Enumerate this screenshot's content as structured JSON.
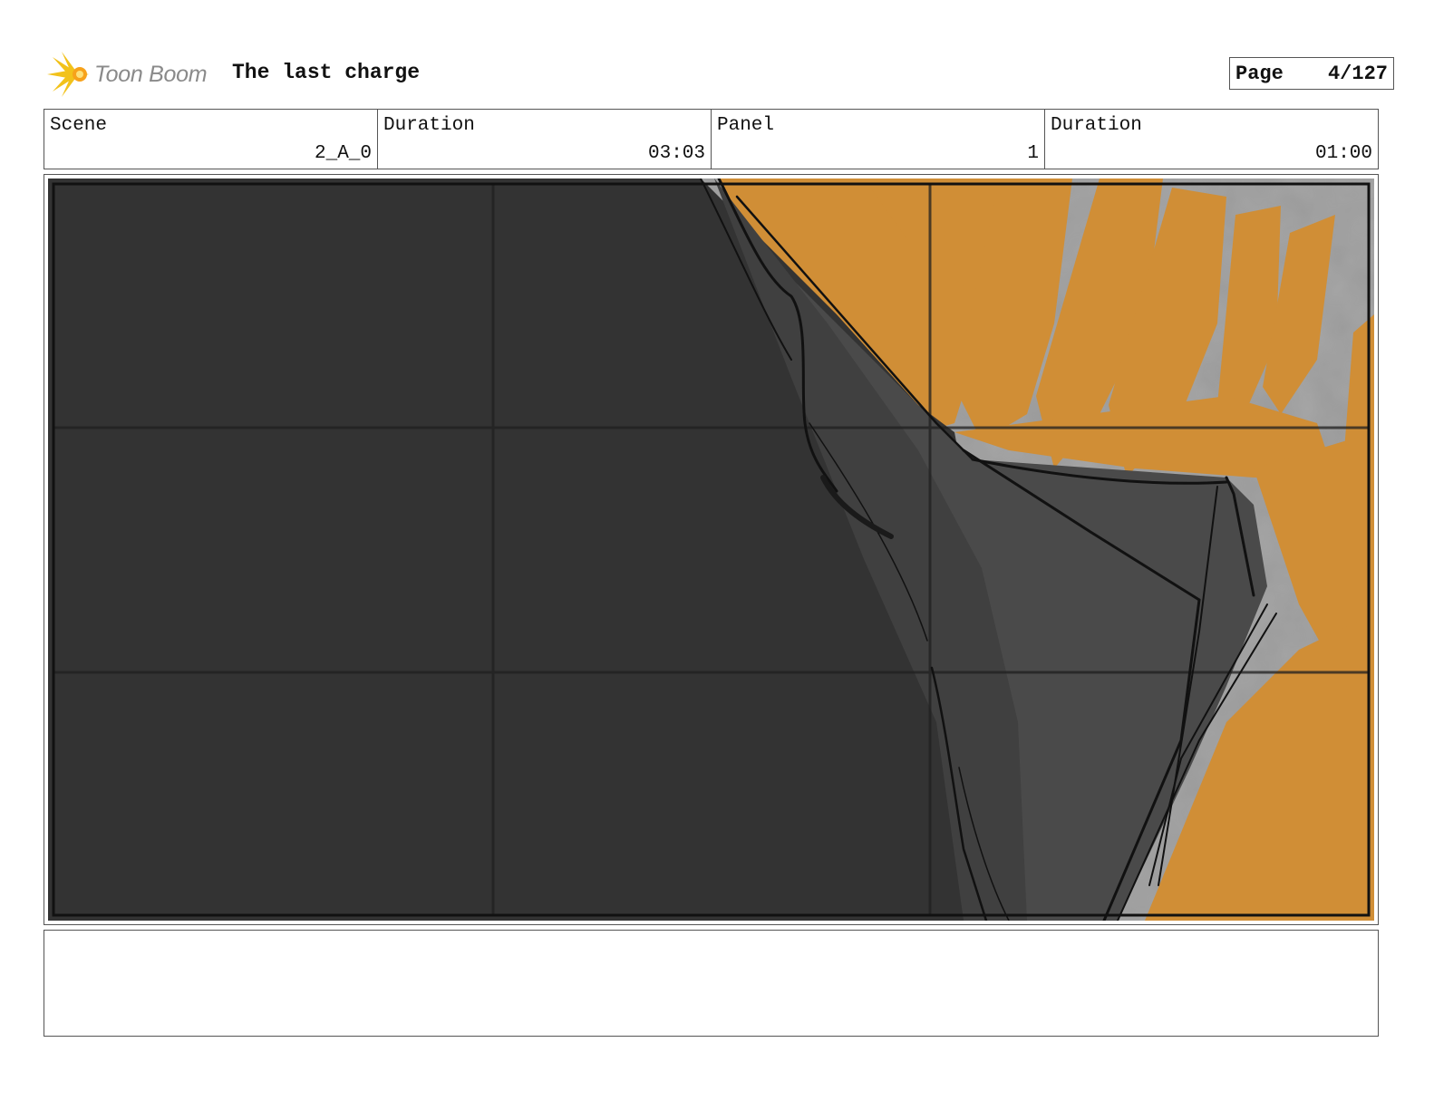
{
  "header": {
    "logo_text": "Toon Boom",
    "project_title": "The last charge",
    "page_label": "Page",
    "page_number": "4/127"
  },
  "info": {
    "scene_label": "Scene",
    "scene_value": "2_A_0",
    "scene_duration_label": "Duration",
    "scene_duration_value": "03:03",
    "panel_label": "Panel",
    "panel_value": "1",
    "panel_duration_label": "Duration",
    "panel_duration_value": "01:00"
  },
  "colors": {
    "dark_fill": "#333333",
    "mid_fill": "#4a4a4a",
    "orange": "#d08e36",
    "grey_bg": "#9a9a9a",
    "grid_line": "#1f1f1f"
  },
  "icons": {
    "logo": "toon-boom-logo-icon"
  }
}
